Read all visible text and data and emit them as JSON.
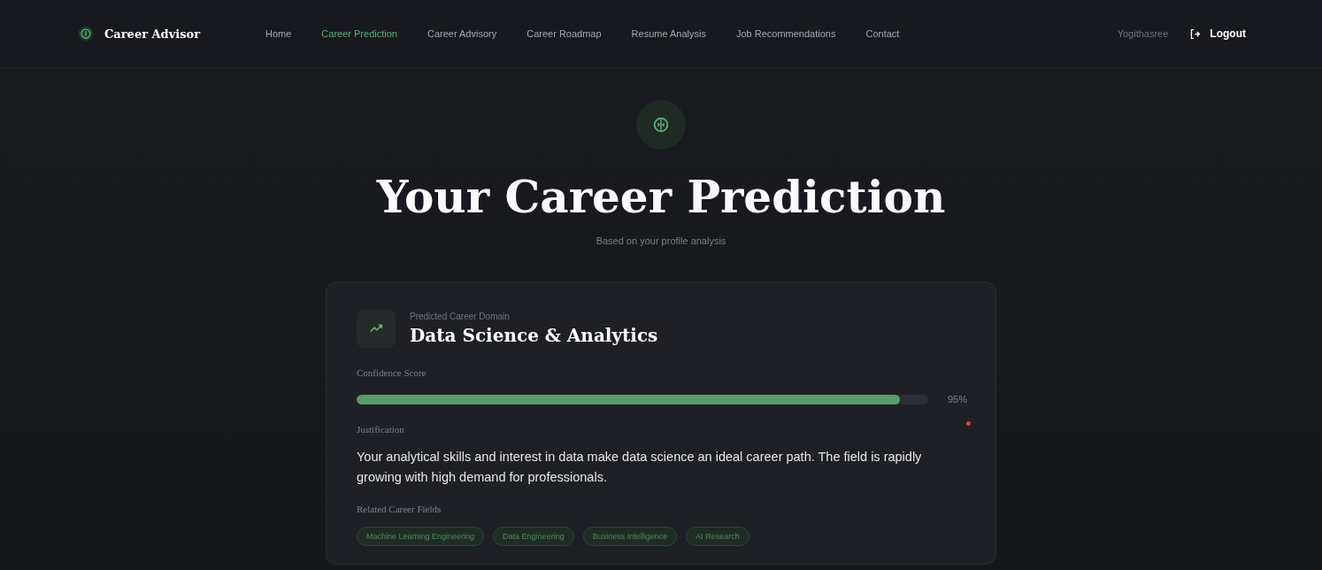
{
  "nav": {
    "brand": "Career Advisor",
    "links": [
      {
        "label": "Home",
        "selected": false
      },
      {
        "label": "Career Prediction",
        "selected": true
      },
      {
        "label": "Career Advisory",
        "selected": false
      },
      {
        "label": "Career Roadmap",
        "selected": false
      },
      {
        "label": "Resume Analysis",
        "selected": false
      },
      {
        "label": "Job Recommendations",
        "selected": false
      },
      {
        "label": "Contact",
        "selected": false
      }
    ],
    "user": "Yogithasree",
    "logout": "Logout"
  },
  "header": {
    "title": "Your Career Prediction",
    "subtitle": "Based on your profile analysis"
  },
  "card": {
    "domain_label": "Predicted Career Domain",
    "domain": "Data Science & Analytics",
    "confidence_label": "Confidence Score",
    "level": 0.95,
    "confidence": "95%",
    "justification_label": "Justification",
    "justification": "Your analytical skills and interest in data make data science an ideal career path. The field is rapidly growing with high demand for professionals.",
    "related_label": "Related Career Fields",
    "related": [
      "Machine Learning Engineering",
      "Data Engineering",
      "Business Intelligence",
      "AI Research"
    ]
  }
}
